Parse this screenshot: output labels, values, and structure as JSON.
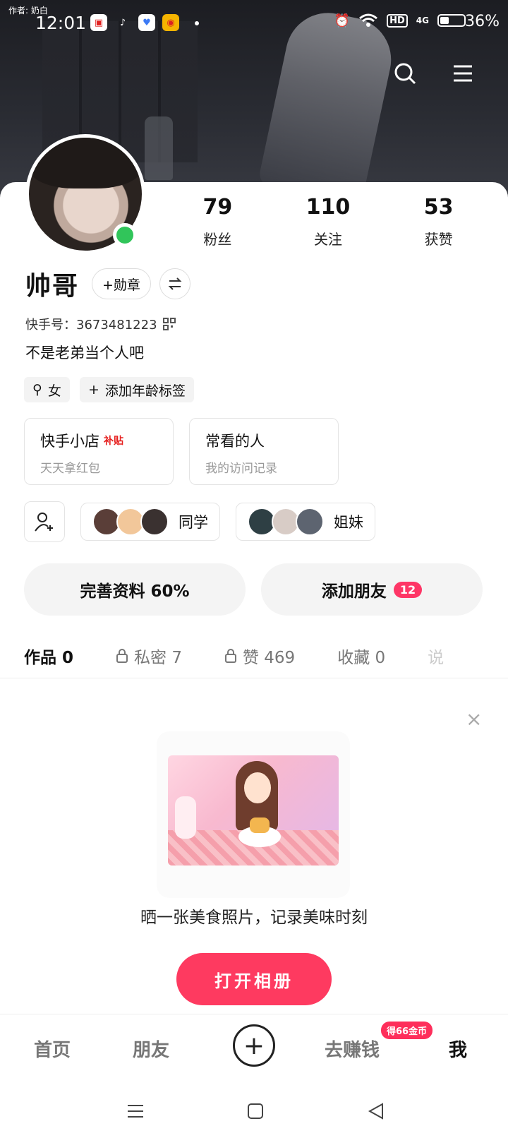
{
  "status_bar": {
    "author": "作者: 奶白",
    "time": "12:01",
    "battery_percent": "36%",
    "hd": "HD",
    "network": "4G"
  },
  "profile": {
    "name": "帅哥",
    "badge_button": "+勋章",
    "kuaishou_id": "快手号：3673481223",
    "bio": "不是老弟当个人吧",
    "gender_tag": "女",
    "age_tag": "添加年龄标签",
    "online": true
  },
  "stats": [
    {
      "value": "79",
      "label": "粉丝"
    },
    {
      "value": "110",
      "label": "关注"
    },
    {
      "value": "53",
      "label": "获赞"
    }
  ],
  "boxes": [
    {
      "title": "快手小店",
      "tag": "补贴",
      "subtitle": "天天拿红包"
    },
    {
      "title": "常看的人",
      "tag": "",
      "subtitle": "我的访问记录"
    }
  ],
  "groups": [
    {
      "label": "同学"
    },
    {
      "label": "姐妹"
    }
  ],
  "big_buttons": {
    "complete_profile": "完善资料 60%",
    "add_friends": "添加朋友",
    "add_friends_badge": "12"
  },
  "tabs": [
    {
      "label": "作品 0",
      "locked": false
    },
    {
      "label": "私密 7",
      "locked": true
    },
    {
      "label": "赞 469",
      "locked": true
    },
    {
      "label": "收藏 0",
      "locked": false
    },
    {
      "label": "说",
      "locked": false
    }
  ],
  "empty_state": {
    "text": "晒一张美食照片，记录美味时刻",
    "button": "打开相册",
    "close": "×"
  },
  "bottom_nav": {
    "home": "首页",
    "friends": "朋友",
    "earn": "去赚钱",
    "earn_badge": "得66金币",
    "me": "我",
    "plus": "+"
  }
}
